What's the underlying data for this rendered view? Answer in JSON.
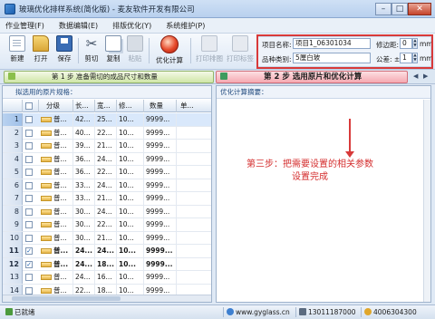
{
  "window": {
    "title": "玻璃优化排样系统(简化版) - 麦友软件开发有限公司",
    "minimize": "–",
    "maximize": "□",
    "close": "✕"
  },
  "menu": [
    "作业管理(F)",
    "数据编辑(E)",
    "排版优化(Y)",
    "系统维护(P)"
  ],
  "toolbar": {
    "new": "新建",
    "open": "打开",
    "save": "保存",
    "cut": "剪切",
    "copy": "复制",
    "paste": "粘贴",
    "optimize": "优化计算",
    "print_layout": "打印排图",
    "print_label": "打印标签",
    "icons": {
      "new": "new-file-icon",
      "open": "folder-open-icon",
      "save": "save-disk-icon",
      "cut": "scissors-icon",
      "copy": "copy-icon",
      "paste": "paste-icon",
      "optimize": "optimize-ball-icon",
      "print_layout": "printer-icon",
      "print_label": "label-printer-icon"
    }
  },
  "params": {
    "project_label": "项目名称:",
    "project_value": "项目1_06301034",
    "trim_label": "修边距:",
    "trim_value": "0",
    "trim_unit": "mm",
    "category_label": "品种类别:",
    "category_value": "5厘白玻",
    "tolerance_label": "公差: ±",
    "tolerance_value": "1",
    "tolerance_unit": "mm"
  },
  "steps": {
    "step1": "第 1 步   准备需切的成品尺寸和数量",
    "step2": "第 2 步   选用原片和优化计算"
  },
  "left_panel": {
    "title": "拟选用的原片规格：",
    "columns": [
      "分级",
      "长...",
      "宽...",
      "修...",
      "数量",
      "单..."
    ],
    "rows": [
      {
        "n": "1",
        "class": "普...",
        "w": "42...",
        "h": "25...",
        "note": "10...",
        "qty": "9999...",
        "price": "",
        "checked": false,
        "bold": false,
        "selected": true
      },
      {
        "n": "2",
        "class": "普...",
        "w": "40...",
        "h": "22...",
        "note": "10...",
        "qty": "9999...",
        "price": "",
        "checked": false,
        "bold": false,
        "selected": false
      },
      {
        "n": "3",
        "class": "普...",
        "w": "39...",
        "h": "21...",
        "note": "10...",
        "qty": "9999...",
        "price": "",
        "checked": false,
        "bold": false,
        "selected": false
      },
      {
        "n": "4",
        "class": "普...",
        "w": "36...",
        "h": "24...",
        "note": "10...",
        "qty": "9999...",
        "price": "",
        "checked": false,
        "bold": false,
        "selected": false
      },
      {
        "n": "5",
        "class": "普...",
        "w": "36...",
        "h": "22...",
        "note": "10...",
        "qty": "9999...",
        "price": "",
        "checked": false,
        "bold": false,
        "selected": false
      },
      {
        "n": "6",
        "class": "普...",
        "w": "33...",
        "h": "24...",
        "note": "10...",
        "qty": "9999...",
        "price": "",
        "checked": false,
        "bold": false,
        "selected": false
      },
      {
        "n": "7",
        "class": "普...",
        "w": "33...",
        "h": "21...",
        "note": "10...",
        "qty": "9999...",
        "price": "",
        "checked": false,
        "bold": false,
        "selected": false
      },
      {
        "n": "8",
        "class": "普...",
        "w": "30...",
        "h": "24...",
        "note": "10...",
        "qty": "9999...",
        "price": "",
        "checked": false,
        "bold": false,
        "selected": false
      },
      {
        "n": "9",
        "class": "普...",
        "w": "30...",
        "h": "22...",
        "note": "10...",
        "qty": "9999...",
        "price": "",
        "checked": false,
        "bold": false,
        "selected": false
      },
      {
        "n": "10",
        "class": "普...",
        "w": "30...",
        "h": "21...",
        "note": "10...",
        "qty": "9999...",
        "price": "",
        "checked": false,
        "bold": false,
        "selected": false
      },
      {
        "n": "11",
        "class": "普...",
        "w": "24...",
        "h": "24...",
        "note": "10...",
        "qty": "9999...",
        "price": "",
        "checked": true,
        "bold": true,
        "selected": false
      },
      {
        "n": "12",
        "class": "普...",
        "w": "24...",
        "h": "18...",
        "note": "10...",
        "qty": "9999...",
        "price": "",
        "checked": true,
        "bold": true,
        "selected": false
      },
      {
        "n": "13",
        "class": "普...",
        "w": "24...",
        "h": "16...",
        "note": "10...",
        "qty": "9999...",
        "price": "",
        "checked": false,
        "bold": false,
        "selected": false
      },
      {
        "n": "14",
        "class": "普...",
        "w": "22...",
        "h": "18...",
        "note": "10...",
        "qty": "9999...",
        "price": "",
        "checked": false,
        "bold": false,
        "selected": false
      }
    ]
  },
  "right_panel": {
    "title": "优化计算摘要：",
    "annotation_line1": "第三步：把需要设置的相关参数",
    "annotation_line2": "设置完成"
  },
  "status": {
    "ready": "已就绪",
    "website": "www.gyglass.cn",
    "phone": "13011187000",
    "qq": "4006304300"
  }
}
